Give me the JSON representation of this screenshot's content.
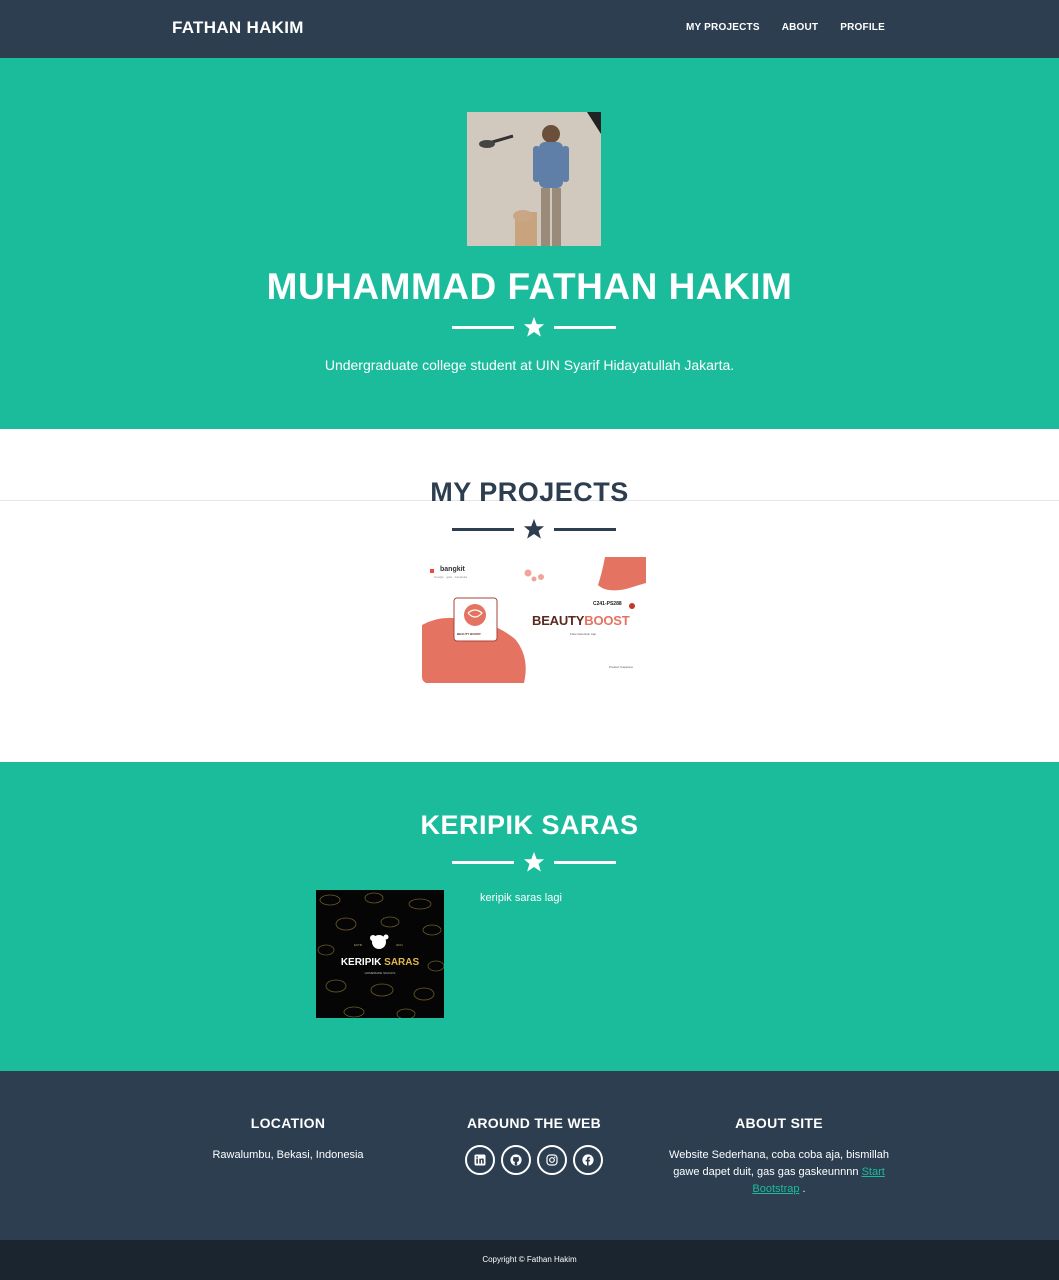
{
  "navbar": {
    "brand": "FATHAN HAKIM",
    "links": [
      "MY PROJECTS",
      "ABOUT",
      "PROFILE"
    ]
  },
  "hero": {
    "title": "MUHAMMAD FATHAN HAKIM",
    "subtitle": "Undergraduate college student at UIN Syarif Hidayatullah Jakarta."
  },
  "projects": {
    "title": "MY PROJECTS",
    "card": {
      "brand_tag": "bangkit",
      "brand_sub": "Google · goto · traveloka",
      "team_code": "C241-PS288",
      "name_part1": "BEAUTY",
      "name_part2": "BOOST",
      "logo_text": "BEAUTY BOOST",
      "subtitle": "Face Detection App",
      "footer_label": "Product Capstone"
    }
  },
  "keripik": {
    "title": "KERIPIK SARAS",
    "description": "keripik saras lagi",
    "logo": {
      "est": "ESTB",
      "year": "2024",
      "word1": "KERIPIK",
      "word2": "SARAS",
      "tagline": "HOMEMADE SNACKS"
    }
  },
  "footer": {
    "location": {
      "heading": "LOCATION",
      "text": "Rawalumbu, Bekasi, Indonesia"
    },
    "web": {
      "heading": "AROUND THE WEB",
      "icons": [
        "linkedin-icon",
        "github-icon",
        "instagram-icon",
        "facebook-icon"
      ]
    },
    "about": {
      "heading": "ABOUT SITE",
      "text": "Website Sederhana, coba coba aja, bismillah gawe dapet duit, gas gas gaskeunnnn",
      "link": "Start Bootstrap",
      "end": "."
    },
    "copyright": "Copyright © Fathan Hakim"
  },
  "colors": {
    "primary": "#1abc9c",
    "secondary": "#2c3e50",
    "dark": "#1a252f",
    "accent_coral": "#e57362"
  }
}
